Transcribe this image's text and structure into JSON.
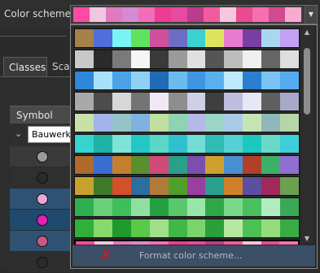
{
  "topbar": {
    "label": "Color scheme",
    "preview_colors": [
      "#ff4aa3",
      "#f0c6e1",
      "#e07ac0",
      "#d58bd1",
      "#f46db9",
      "#ea3d91",
      "#e64aa1",
      "#ba3c8d",
      "#f15aa0",
      "#f7c7dd",
      "#e94a91",
      "#f76fb0",
      "#d14a8f",
      "#f8aad0"
    ],
    "dropdown_arrow": "triangle-down-icon"
  },
  "panel": {
    "tabs": [
      "Classes",
      "Scale"
    ],
    "column_header": "Symbol",
    "expand_icon": "chevron-down-icon",
    "first_row_value": "Bauwerks",
    "symbol_colors": [
      "#9a9a9a",
      "#2b2b2b",
      "#e6a8d8",
      "#e021b5",
      "#c85a85",
      "#2b2b2b"
    ],
    "row_backgrounds": [
      "#3a3a3a",
      "#2f2f2f",
      "#2f5272",
      "#1f4a6e",
      "#2f5272",
      "#2e2e2e"
    ]
  },
  "popup": {
    "palettes": [
      [
        "#a6824a",
        "#4f6fdc",
        "#7af3f3",
        "#5fe35f",
        "#d0509c",
        "#6d6dc7",
        "#3bd1d1",
        "#dfe45f",
        "#e77bd0",
        "#7a3fa3",
        "#a9d7f0",
        "#c3a0f5"
      ],
      [
        "#c8c8c8",
        "#2b2b2b",
        "#7a7a7a",
        "#f5f5f5",
        "#3a3a3a",
        "#9a9a9a",
        "#e0e0e0",
        "#555555",
        "#bdbdbd",
        "#f0f0f0",
        "#666666",
        "#dedede"
      ],
      [
        "#2d88d8",
        "#a8e1fa",
        "#4aa2e8",
        "#8fd1f5",
        "#206bb5",
        "#6cbbee",
        "#3f96e0",
        "#5ab0ec",
        "#bdeafd",
        "#2b7ed0",
        "#7ac4f3",
        "#54abf0"
      ],
      [
        "#a9a9a9",
        "#4c4c4c",
        "#d7d7d7",
        "#747474",
        "#f0e8f5",
        "#8e8e8e",
        "#cfcfe8",
        "#3f3f3f",
        "#bdbde0",
        "#e6e6f5",
        "#5f5f5f",
        "#a8a8c8"
      ],
      [
        "#c9e0a8",
        "#a2b5ea",
        "#95c3c6",
        "#7fb2e0",
        "#c0dfa0",
        "#8fd3b4",
        "#b4b9e8",
        "#9ad5c7",
        "#aacbe8",
        "#c6e5b7",
        "#8fb8b8",
        "#b6d6a8"
      ],
      [
        "#37d3cf",
        "#1fb3a8",
        "#7fe3d6",
        "#25c6c6",
        "#5ad7c6",
        "#2fc0d1",
        "#73ddd6",
        "#30bcb5",
        "#54d1d7",
        "#1dc8be",
        "#69dac8",
        "#3ccfd9"
      ],
      [
        "#b06a2a",
        "#3a6fd0",
        "#c4802f",
        "#5a8f2f",
        "#d04a7a",
        "#2a9f8a",
        "#7a4fb0",
        "#d0a02f",
        "#4a8fd0",
        "#b0402a",
        "#3fb06a",
        "#8f6fd0"
      ],
      [
        "#c8a22f",
        "#3e7a2a",
        "#d4502a",
        "#2a6fa0",
        "#b07a3a",
        "#4fa02a",
        "#9a3fa0",
        "#2aa08f",
        "#d0802a",
        "#5a4fa0",
        "#a02a5a",
        "#6aa04f"
      ],
      [
        "#2fb04f",
        "#6ad07a",
        "#3fbf5a",
        "#8fe0a0",
        "#24a040",
        "#5ac86a",
        "#9ae6aa",
        "#2fa84a",
        "#7ad88a",
        "#4abf60",
        "#b0ecbf",
        "#3aa856"
      ],
      [
        "#2fb03a",
        "#86d96b",
        "#1f9a2f",
        "#5bc84a",
        "#a0e08a",
        "#3fb84a",
        "#7ad46a",
        "#2aa03a",
        "#b6e8a0",
        "#4cc055",
        "#93dd7c",
        "#37ad44"
      ],
      [
        "#ff4aa3",
        "#f0c6e1",
        "#e07ac0",
        "#d58bd1",
        "#f46db9",
        "#ea3d91",
        "#e64aa1",
        "#ba3c8d",
        "#f15aa0",
        "#f7c7dd",
        "#e94a91",
        "#f76fb0"
      ],
      [
        "#c4b08a",
        "#8a9ab0",
        "#b08a6a",
        "#9ac0a8",
        "#d0b89a",
        "#7a8ab0",
        "#c8a07a",
        "#a0b8c8",
        "#b89a80",
        "#8ab09a",
        "#d0c0a0",
        "#9aa8c0"
      ]
    ],
    "selected_index": 10,
    "scroll_up_icon": "scroll-up-icon",
    "scroll_down_icon": "scroll-down-icon",
    "format_label": "Format color scheme..."
  }
}
